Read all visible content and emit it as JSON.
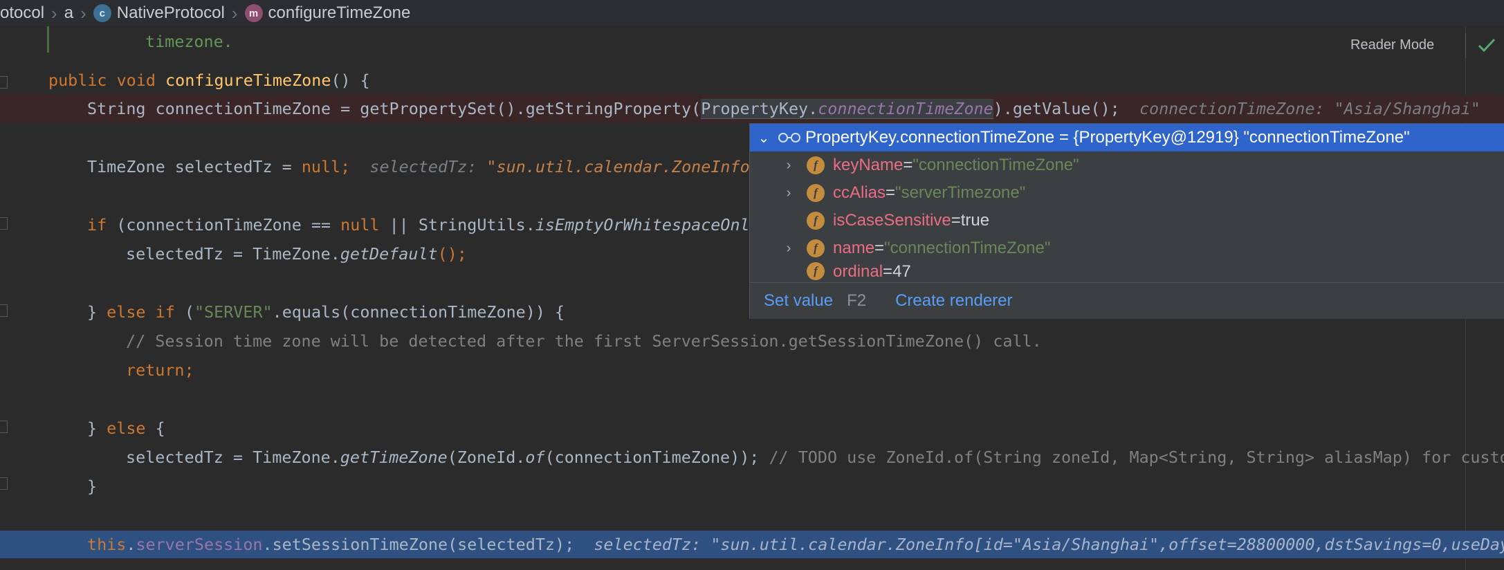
{
  "breadcrumb": {
    "items": [
      {
        "label": "otocol",
        "icon": null
      },
      {
        "label": "a",
        "icon": null
      },
      {
        "label": "NativeProtocol",
        "icon": "class-icon",
        "icon_letter": "c"
      },
      {
        "label": "configureTimeZone",
        "icon": "method-icon",
        "icon_letter": "m"
      }
    ]
  },
  "editor": {
    "reader_mode_label": "Reader Mode",
    "doc_tail": "timezone.",
    "line1": {
      "kw_public": "public",
      "kw_void": "void",
      "method": "configureTimeZone",
      "rest": "() {"
    },
    "line2": {
      "code_a": "String connectionTimeZone = getPropertySet().getStringProperty(",
      "cls": "PropertyKey.",
      "field": "connectionTimeZone",
      "code_b": ").getValue();",
      "hint": "connectionTimeZone: \"Asia/Shanghai\""
    },
    "line3": {
      "code": "TimeZone selectedTz = ",
      "kw_null": "null",
      "semi": ";",
      "hint_name": "selectedTz: ",
      "hint_val": "\"sun.util.calendar.ZoneInfo"
    },
    "line4": {
      "kw_if": "if",
      "a": " (connectionTimeZone == ",
      "kw_null": "null",
      "b": " || StringUtils.",
      "fn": "isEmptyOrWhitespaceOnl("
    },
    "line5": {
      "a": "selectedTz = TimeZone.",
      "fn": "getDefault",
      "b": "();"
    },
    "line6": {
      "a": "} ",
      "kw_else": "else",
      "sp": " ",
      "kw_if": "if",
      "b": " (",
      "str": "\"SERVER\"",
      "c": ".equals(connectionTimeZone)) {"
    },
    "line7": {
      "comment": "// Session time zone will be detected after the first ServerSession.getSessionTimeZone() call."
    },
    "line8": {
      "kw_return": "return;"
    },
    "line9": {
      "a": "} ",
      "kw_else": "else",
      "b": " {"
    },
    "line10": {
      "a": "selectedTz = TimeZone.",
      "fn1": "getTimeZone",
      "b": "(ZoneId.",
      "fn2": "of",
      "c": "(connectionTimeZone)); ",
      "comment": "// TODO use ZoneId.of(String zoneId, Map<String, String> aliasMap) for custon"
    },
    "line11": {
      "a": "}"
    },
    "line12": {
      "kw_this": "this",
      "dot": ".",
      "field": "serverSession",
      "b": ".setSessionTimeZone(selectedTz);",
      "hint": "selectedTz: \"sun.util.calendar.ZoneInfo[id=\"Asia/Shanghai\",offset=28800000,dstSavings=0,useDay"
    }
  },
  "popup": {
    "header": "PropertyKey.connectionTimeZone = {PropertyKey@12919} \"connectionTimeZone\"",
    "rows": [
      {
        "name": "keyName",
        "eq": " = ",
        "value": "\"connectionTimeZone\"",
        "kind": "string",
        "expandable": true
      },
      {
        "name": "ccAlias",
        "eq": " = ",
        "value": "\"serverTimezone\"",
        "kind": "string",
        "expandable": true
      },
      {
        "name": "isCaseSensitive",
        "eq": " = ",
        "value": "true",
        "kind": "plain",
        "expandable": false
      },
      {
        "name": "name",
        "eq": " = ",
        "value": "\"connectionTimeZone\"",
        "kind": "string",
        "expandable": true
      },
      {
        "name": "ordinal",
        "eq": " = ",
        "value": "47",
        "kind": "plain",
        "expandable": false
      }
    ],
    "set_value_label": "Set value",
    "set_value_shortcut": "F2",
    "create_renderer_label": "Create renderer"
  }
}
